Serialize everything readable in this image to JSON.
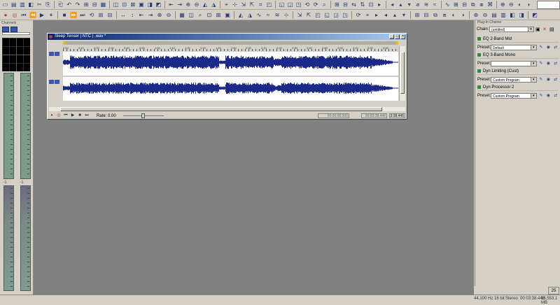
{
  "document": {
    "title": "Sleep Tenser | NTC | .wav *",
    "rate_label": "Rate: 0.00",
    "time_start": "00:00:00.000",
    "time_end": "00:03:38.446",
    "length": "3:38.446",
    "ruler_ticks": [
      "0:00",
      "0:10",
      "0:20",
      "0:30",
      "0:40",
      "0:50",
      "1:00",
      "1:10",
      "1:20",
      "1:30",
      "1:40",
      "1:50",
      "2:00",
      "2:10",
      "2:20",
      "2:30",
      "2:40",
      "2:50",
      "3:00",
      "3:10",
      "3:20",
      "3:30"
    ]
  },
  "left_panel": {
    "title": "Channels",
    "meter_top_labels": [
      "-1",
      "-1"
    ],
    "meter_bottom_labels": [
      "-1",
      "-1"
    ]
  },
  "right_panel": {
    "title": "Plug-In Chainer",
    "chain_label": "Chain:",
    "chain_value": "(untitled)",
    "plugins": [
      {
        "name": "EQ 2-Band Mid",
        "preset_label": "Preset:",
        "preset_value": "Default"
      },
      {
        "name": "EQ 3-Band Mono",
        "preset_label": "Preset:",
        "preset_value": ""
      },
      {
        "name": "Dyn Limiting (Cust)",
        "preset_label": "Preset:",
        "preset_value": "Custom Program"
      },
      {
        "name": "Dyn Processor 2",
        "preset_label": "Preset:",
        "preset_value": "Custom Program"
      }
    ]
  },
  "status_bar": {
    "items": [
      "44,100 Hz",
      "16 bit",
      "Stereo",
      "00:03:38.446",
      "15,553.1 MB"
    ],
    "corner": "25"
  },
  "colors": {
    "workspace": "#808080",
    "waveform": "#1b2a88",
    "titlebar": "#0a246a"
  }
}
